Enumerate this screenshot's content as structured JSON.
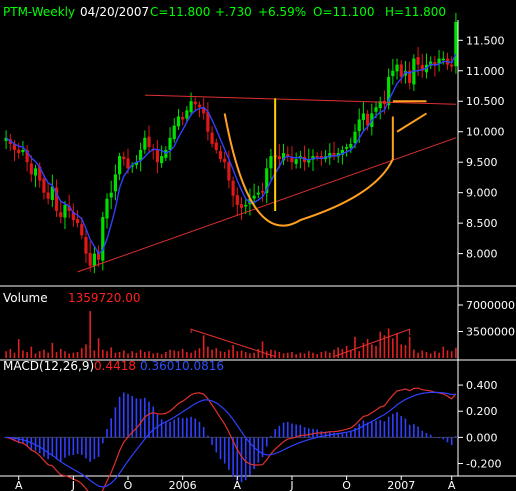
{
  "header": {
    "symbol": "PTM-Weekly",
    "date": "04/20/2007",
    "close": "C=11.800",
    "change": "+.730",
    "change_pct": "+6.59%",
    "open": "O=11.100",
    "high": "H=11.800"
  },
  "volume_panel": {
    "label": "Volume",
    "value": "1359720.00"
  },
  "macd_panel": {
    "label": "MACD(12,26,9)",
    "v1": "0.4418",
    "v2": "0.3601",
    "v3": "0.0816"
  },
  "colors": {
    "background": "#000000",
    "up": "#00e000",
    "down": "#e01818",
    "header_symbol": "#00ff00",
    "header_values": "#00ff00",
    "trendline": "#e03030",
    "pattern": "#ffa020",
    "marker": "#ffd000",
    "ma": "#3040ff",
    "macd_line": "#e03030",
    "signal_line": "#3040ff",
    "hist": "#3040ff",
    "volume_bar": "#e02020"
  },
  "chart_data": [
    {
      "type": "candlestick",
      "title": "PTM-Weekly",
      "ylim": [
        7.6,
        11.8
      ],
      "ticks": [
        "11.500",
        "11.000",
        "10.500",
        "10.000",
        "9.500",
        "9.000",
        "8.500",
        "8.000"
      ],
      "tick_values": [
        11.5,
        11.0,
        10.5,
        10.0,
        9.5,
        9.0,
        8.5,
        8.0
      ],
      "x_labels": [
        "A",
        "J",
        "O",
        "2006",
        "A",
        "J",
        "O",
        "2007",
        "A"
      ],
      "weeks": 108,
      "label_weeks": [
        3,
        16,
        29,
        42,
        55,
        68,
        81,
        94,
        106
      ],
      "closes": [
        9.9,
        9.8,
        9.7,
        9.65,
        9.7,
        9.5,
        9.3,
        9.4,
        9.2,
        9.0,
        8.9,
        9.1,
        8.7,
        8.6,
        8.8,
        8.7,
        8.55,
        8.5,
        8.3,
        8.0,
        7.8,
        8.0,
        7.9,
        8.6,
        8.9,
        9.0,
        9.3,
        9.6,
        9.55,
        9.4,
        9.45,
        9.5,
        9.7,
        9.9,
        9.75,
        9.7,
        9.5,
        9.6,
        9.7,
        9.9,
        10.1,
        10.25,
        10.2,
        10.35,
        10.5,
        10.45,
        10.4,
        10.3,
        10.0,
        9.8,
        9.7,
        9.55,
        9.5,
        9.2,
        8.95,
        8.8,
        8.75,
        8.8,
        8.9,
        8.95,
        9.0,
        9.0,
        9.4,
        9.6,
        9.6,
        9.55,
        9.65,
        9.6,
        9.5,
        9.55,
        9.6,
        9.5,
        9.55,
        9.6,
        9.6,
        9.55,
        9.6,
        9.65,
        9.6,
        9.65,
        9.7,
        9.75,
        9.8,
        10.0,
        10.2,
        10.3,
        10.1,
        10.3,
        10.4,
        10.5,
        10.45,
        10.9,
        11.0,
        11.1,
        10.9,
        11.0,
        10.8,
        11.2,
        11.1,
        11.0,
        11.1,
        11.15,
        11.1,
        11.2,
        11.2,
        11.1,
        11.07,
        11.8
      ],
      "annotations": {
        "support_line": [
          [
            17,
            7.7
          ],
          [
            107,
            9.9
          ]
        ],
        "upper_line": [
          [
            33,
            10.6
          ],
          [
            107,
            10.45
          ]
        ],
        "vertical_marker_week": 64
      }
    },
    {
      "type": "bar",
      "title": "Volume",
      "ylim": [
        0,
        7000000
      ],
      "ticks": [
        "7000000",
        "3500000"
      ],
      "tick_values": [
        7000000,
        3500000
      ],
      "values": [
        900000,
        1200000,
        700000,
        2500000,
        1000000,
        800000,
        1500000,
        600000,
        900000,
        1100000,
        700000,
        2000000,
        800000,
        1200000,
        900000,
        600000,
        700000,
        800000,
        1300000,
        1800000,
        6200000,
        1000000,
        2600000,
        1100000,
        900000,
        1400000,
        700000,
        800000,
        1000000,
        600000,
        900000,
        700000,
        1100000,
        800000,
        900000,
        600000,
        700000,
        500000,
        800000,
        1100000,
        1000000,
        900000,
        1200000,
        800000,
        700000,
        1000000,
        1300000,
        3000000,
        1500000,
        1100000,
        1300000,
        900000,
        800000,
        1100000,
        1700000,
        900000,
        1000000,
        800000,
        600000,
        700000,
        1200000,
        2200000,
        900000,
        1100000,
        1000000,
        800000,
        600000,
        700000,
        800000,
        500000,
        700000,
        600000,
        900000,
        700000,
        500000,
        800000,
        900000,
        700000,
        1100000,
        1400000,
        1200000,
        1600000,
        1000000,
        2800000,
        900000,
        2000000,
        2500000,
        1800000,
        1600000,
        3500000,
        3000000,
        3900000,
        2600000,
        3300000,
        1800000,
        1700000,
        2800000,
        1100000,
        700000,
        1000000,
        800000,
        600000,
        900000,
        700000,
        1500000,
        1000000,
        900000,
        1359720
      ]
    },
    {
      "type": "line",
      "title": "MACD(12,26,9)",
      "ylim": [
        -0.28,
        0.5
      ],
      "ticks": [
        "0.400",
        "0.200",
        "0.000",
        "-0.200"
      ],
      "tick_values": [
        0.4,
        0.2,
        0.0,
        -0.2
      ]
    }
  ]
}
